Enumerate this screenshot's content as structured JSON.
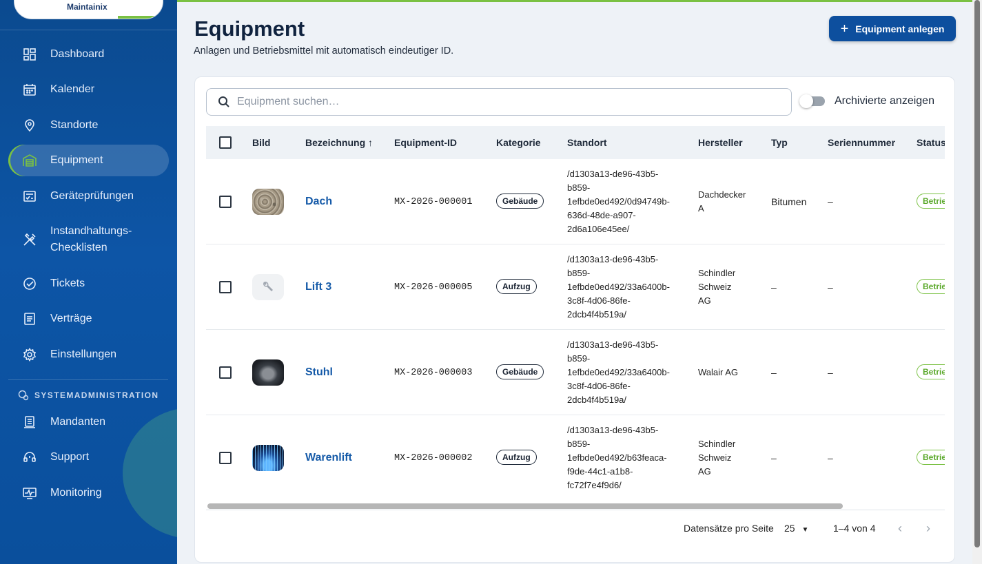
{
  "app": {
    "logo_text": "Maintainix"
  },
  "sidebar": {
    "items": [
      {
        "label": "Dashboard",
        "icon": "dashboard-icon"
      },
      {
        "label": "Kalender",
        "icon": "calendar-icon"
      },
      {
        "label": "Standorte",
        "icon": "location-pin-icon"
      },
      {
        "label": "Equipment",
        "icon": "building-icon",
        "active": true
      },
      {
        "label": "Geräteprüfungen",
        "icon": "checkbox-list-icon"
      },
      {
        "label": "Instandhaltungs-Checklisten",
        "label_line1": "Instandhaltungs-",
        "label_line2": "Checklisten",
        "icon": "tools-icon"
      },
      {
        "label": "Tickets",
        "icon": "check-circle-icon"
      },
      {
        "label": "Verträge",
        "icon": "document-icon"
      },
      {
        "label": "Einstellungen",
        "icon": "gear-icon"
      }
    ],
    "system_heading": "SYSTEMADMINISTRATION",
    "system_items": [
      {
        "label": "Mandanten",
        "icon": "tenants-icon"
      },
      {
        "label": "Support",
        "icon": "headset-icon"
      },
      {
        "label": "Monitoring",
        "icon": "monitor-icon"
      }
    ]
  },
  "header": {
    "title": "Equipment",
    "subtitle": "Anlagen und Betriebsmittel mit automatisch eindeutiger ID.",
    "add_button": "Equipment anlegen"
  },
  "search": {
    "placeholder": "Equipment suchen…",
    "value": ""
  },
  "archive_toggle": {
    "label": "Archivierte anzeigen",
    "on": false
  },
  "table": {
    "columns": [
      "Bild",
      "Bezeichnung ↑",
      "Equipment-ID",
      "Kategorie",
      "Standort",
      "Hersteller",
      "Typ",
      "Seriennummer",
      "Status"
    ],
    "rows": [
      {
        "name": "Dach",
        "id": "MX-2026-000001",
        "category": "Gebäude",
        "location_lines": [
          "/d1303a13-de96-43b5-",
          "b859-",
          "1efbde0ed492/0d94749b-",
          "636d-48de-a907-",
          "2d6a106e45ee/"
        ],
        "manufacturer_lines": [
          "Dachdecker",
          "A"
        ],
        "type": "Bitumen",
        "serial": "–",
        "status": "Betrieb",
        "image": "gravel-photo"
      },
      {
        "name": "Lift 3",
        "id": "MX-2026-000005",
        "category": "Aufzug",
        "location_lines": [
          "/d1303a13-de96-43b5-",
          "b859-",
          "1efbde0ed492/33a6400b-",
          "3c8f-4d06-86fe-",
          "2dcb4f4b519a/"
        ],
        "manufacturer_lines": [
          "Schindler",
          "Schweiz",
          "AG"
        ],
        "type": "–",
        "serial": "–",
        "status": "Betrieb",
        "image": "wrench-placeholder-icon"
      },
      {
        "name": "Stuhl",
        "id": "MX-2026-000003",
        "category": "Gebäude",
        "location_lines": [
          "/d1303a13-de96-43b5-",
          "b859-",
          "1efbde0ed492/33a6400b-",
          "3c8f-4d06-86fe-",
          "2dcb4f4b519a/"
        ],
        "manufacturer_lines": [
          "Walair AG"
        ],
        "type": "–",
        "serial": "–",
        "status": "Betrieb",
        "image": "chair-photo"
      },
      {
        "name": "Warenlift",
        "id": "MX-2026-000002",
        "category": "Aufzug",
        "location_lines": [
          "/d1303a13-de96-43b5-",
          "b859-",
          "1efbde0ed492/b63feaca-",
          "f9de-44c1-a1b8-",
          "fc72f7e4f9d6/"
        ],
        "manufacturer_lines": [
          "Schindler",
          "Schweiz",
          "AG"
        ],
        "type": "–",
        "serial": "–",
        "status": "Betrieb",
        "image": "lights-photo"
      }
    ]
  },
  "pagination": {
    "rows_per_page_label": "Datensätze pro Seite",
    "rows_per_page": "25",
    "range": "1–4 von 4"
  },
  "colors": {
    "primary": "#0d4f9e",
    "accent": "#7ac143",
    "link": "#155aa8"
  }
}
